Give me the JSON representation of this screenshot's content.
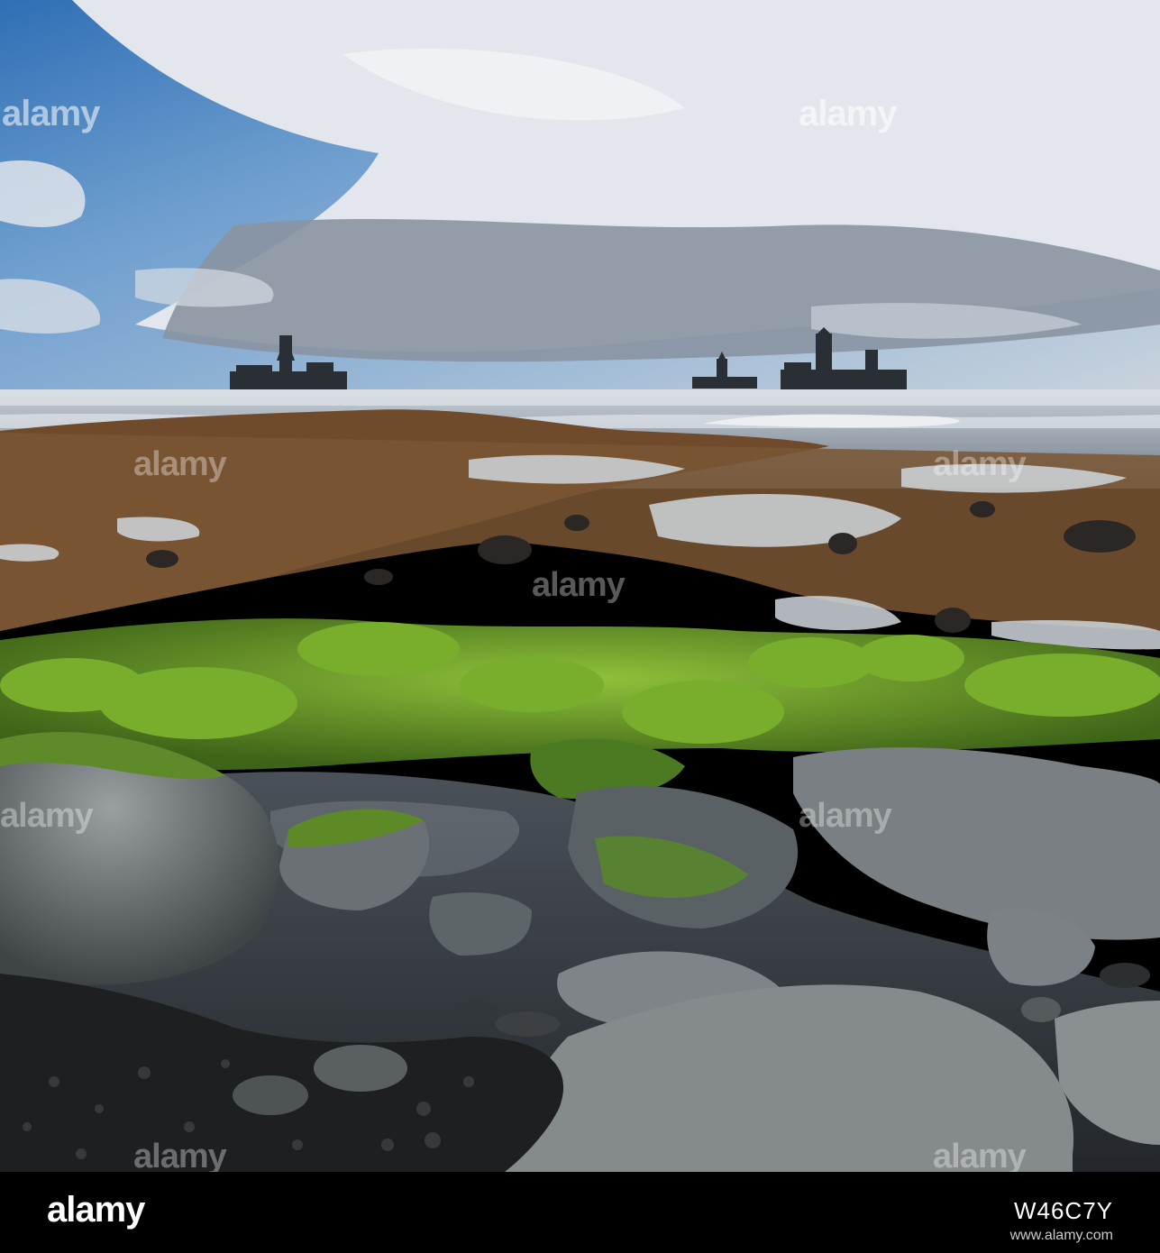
{
  "watermark": {
    "brand": "alamy",
    "image_id": "W46C7Y",
    "url": "www.alamy.com"
  },
  "colors": {
    "sky_blue": "#3f7fc0",
    "cloud": "#e6e9ef",
    "cloud_shadow": "#7f8796",
    "sea": "#9aa6b4",
    "algae_green": "#6a9a2a",
    "algae_brown": "#7a5634",
    "rock_gray": "#6f7476",
    "pebble_black": "#1e1f21"
  }
}
